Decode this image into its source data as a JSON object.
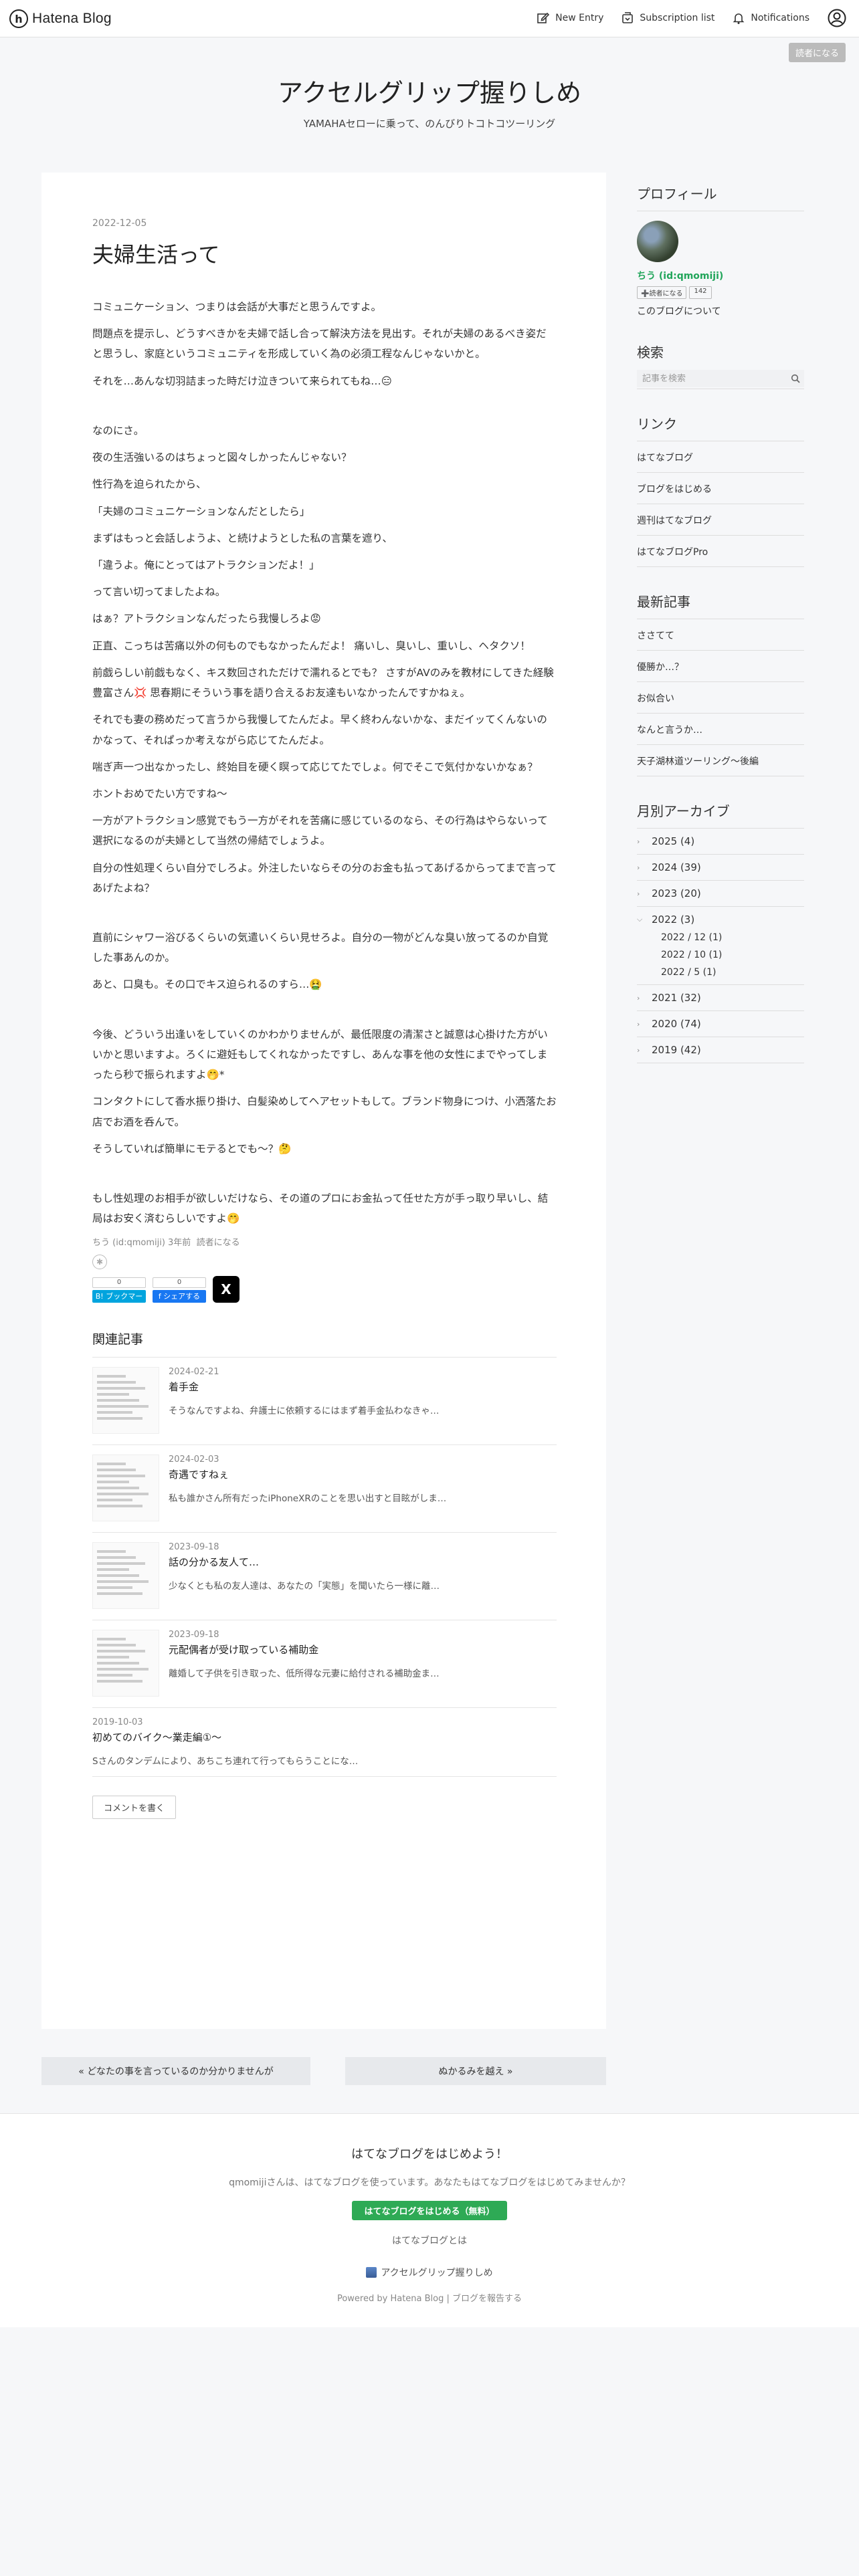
{
  "header": {
    "logo_text": "Hatena Blog",
    "new_entry": "New Entry",
    "subscription_list": "Subscription list",
    "notifications": "Notifications",
    "icons": [
      "hatena-logo-icon",
      "pencil-icon",
      "subscription-icon",
      "bell-icon",
      "user-icon"
    ]
  },
  "reader_button": "読者になる",
  "blog": {
    "title": "アクセルグリップ握りしめ",
    "description": "YAMAHAセローに乗って、のんびりトコトコツーリング"
  },
  "entry": {
    "date": "2022-12-05",
    "title": "夫婦生活って",
    "paragraphs": [
      {
        "text": "コミュニケーション、つまりは会話が大事だと思うんですよ。",
        "gap": false
      },
      {
        "text": "問題点を提示し、どうすべきかを夫婦で話し合って解決方法を見出す。それが夫婦のあるべき姿だと思うし、家庭というコミュニティを形成していく為の必須工程なんじゃないかと。",
        "gap": false
      },
      {
        "text": "それを…あんな切羽詰まった時だけ泣きついて来られてもね…😑",
        "gap": true
      },
      {
        "text": "なのにさ。",
        "gap": false
      },
      {
        "text": "夜の生活強いるのはちょっと図々しかったんじゃない？",
        "gap": false
      },
      {
        "text": "性行為を迫られたから、",
        "gap": false
      },
      {
        "text": "「夫婦のコミュニケーションなんだとしたら」",
        "gap": false
      },
      {
        "text": "まずはもっと会話しようよ、と続けようとした私の言葉を遮り、",
        "gap": false
      },
      {
        "text": "「違うよ。俺にとってはアトラクションだよ！」",
        "gap": false
      },
      {
        "text": "って言い切ってましたよね。",
        "gap": false
      },
      {
        "text": "はぁ？アトラクションなんだったら我慢しろよ😡",
        "gap": false
      },
      {
        "text": "正直、こっちは苦痛以外の何ものでもなかったんだよ！ 痛いし、臭いし、重いし、ヘタクソ！",
        "gap": false
      },
      {
        "text": "前戯らしい前戯もなく、キス数回されただけで濡れるとでも？ さすがAVのみを教材にしてきた経験豊富さん💢 思春期にそういう事を語り合えるお友達もいなかったんですかねぇ。",
        "gap": false
      },
      {
        "text": "それでも妻の務めだって言うから我慢してたんだよ。早く終わんないかな、まだイッてくんないのかなって、それぱっか考えながら応じてたんだよ。",
        "gap": false
      },
      {
        "text": "喘ぎ声一つ出なかったし、終始目を硬く瞑って応じてたでしょ。何でそこで気付かないかなぁ？",
        "gap": false
      },
      {
        "text": "ホントおめでたい方ですね〜",
        "gap": false
      },
      {
        "text": "一方がアトラクション感覚でもう一方がそれを苦痛に感じているのなら、その行為はやらないって選択になるのが夫婦として当然の帰結でしょうよ。",
        "gap": false
      },
      {
        "text": "自分の性処理くらい自分でしろよ。外注したいならその分のお金も払ってあげるからってまで言ってあげたよね？",
        "gap": true
      },
      {
        "text": "直前にシャワー浴びるくらいの気遣いくらい見せろよ。自分の一物がどんな臭い放ってるのか自覚した事あんのか。",
        "gap": false
      },
      {
        "text": "あと、口臭も。その口でキス迫られるのすら…🤮",
        "gap": true
      },
      {
        "text": "今後、どういう出逢いをしていくのかわかりませんが、最低限度の清潔さと誠意は心掛けた方がいいかと思いますよ。ろくに避妊もしてくれなかったですし、あんな事を他の女性にまでやってしまったら秒で振られますよ🤭*",
        "gap": false
      },
      {
        "text": "コンタクトにして香水振り掛け、白髪染めしてヘアセットもして。ブランド物身につけ、小洒落たお店でお酒を呑んで。",
        "gap": false
      },
      {
        "text": "そうしていれば簡単にモテるとでも〜？🤔",
        "gap": true
      },
      {
        "text": "もし性処理のお相手が欲しいだけなら、その道のプロにお金払って任せた方が手っ取り早いし、結局はお安く済むらしいですよ🤭",
        "gap": false
      }
    ],
    "footer_author": "ちう (id:qmomiji)",
    "footer_time": "3年前",
    "footer_reader": "読者になる",
    "bookmark_count": "0",
    "bookmark_label": "B! ブックマーク",
    "facebook_count": "0",
    "facebook_label": "f シェアする",
    "x_label": "X"
  },
  "related": {
    "title": "関連記事",
    "items": [
      {
        "date": "2024-02-21",
        "title": "着手金",
        "snippet": "そうなんですよね、弁護士に依頼するにはまず着手金払わなきゃ…"
      },
      {
        "date": "2024-02-03",
        "title": "奇遇ですねぇ",
        "snippet": "私も誰かさん所有だったiPhoneXRのことを思い出すと目眩がしま…"
      },
      {
        "date": "2023-09-18",
        "title": "話の分かる友人て…",
        "snippet": "少なくとも私の友人達は、あなたの「実態」を聞いたら一様に離…"
      },
      {
        "date": "2023-09-18",
        "title": "元配偶者が受け取っている補助金",
        "snippet": "離婚して子供を引き取った、低所得な元妻に給付される補助金ま…"
      },
      {
        "date": "2019-10-03",
        "title": "初めてのバイク〜業走編①〜",
        "snippet": "Sさんのタンデムにより、あちこち連れて行ってもらうことにな…"
      }
    ],
    "comment_button": "コメントを書く"
  },
  "pager": {
    "prev": "« どなたの事を言っているのか分かりませんが",
    "next": "ぬかるみを越え »"
  },
  "sidebar": {
    "profile_title": "プロフィール",
    "profile_name": "ちう (id:qmomiji)",
    "profile_reader": "➕読者になる",
    "profile_reader_count": "142",
    "profile_link": "このブログについて",
    "search_title": "検索",
    "search_placeholder": "記事を検索",
    "links_title": "リンク",
    "links": [
      "はてなブログ",
      "ブログをはじめる",
      "週刊はてなブログ",
      "はてなブログPro"
    ],
    "recent_title": "最新記事",
    "recent": [
      "ささてて",
      "優勝か…？",
      "お似合い",
      "なんと言うか…",
      "天子湖林道ツーリング〜後編"
    ],
    "archive_title": "月別アーカイブ",
    "archive_before": [
      "2025 (4)",
      "2024 (39)",
      "2023 (20)"
    ],
    "archive_open": "2022 (3)",
    "archive_open_subs": [
      "2022 / 12 (1)",
      "2022 / 10 (1)",
      "2022 / 5 (1)"
    ],
    "archive_after": [
      "2021 (32)",
      "2020 (74)",
      "2019 (42)"
    ]
  },
  "footer": {
    "title": "はてなブログをはじめよう！",
    "text": "qmomijiさんは、はてなブログを使っています。あなたもはてなブログをはじめてみませんか？",
    "cta": "はてなブログをはじめる（無料）",
    "about": "はてなブログとは",
    "blog_link": "アクセルグリップ握りしめ",
    "powered_by": "Powered by Hatena Blog",
    "report": "ブログを報告する"
  }
}
